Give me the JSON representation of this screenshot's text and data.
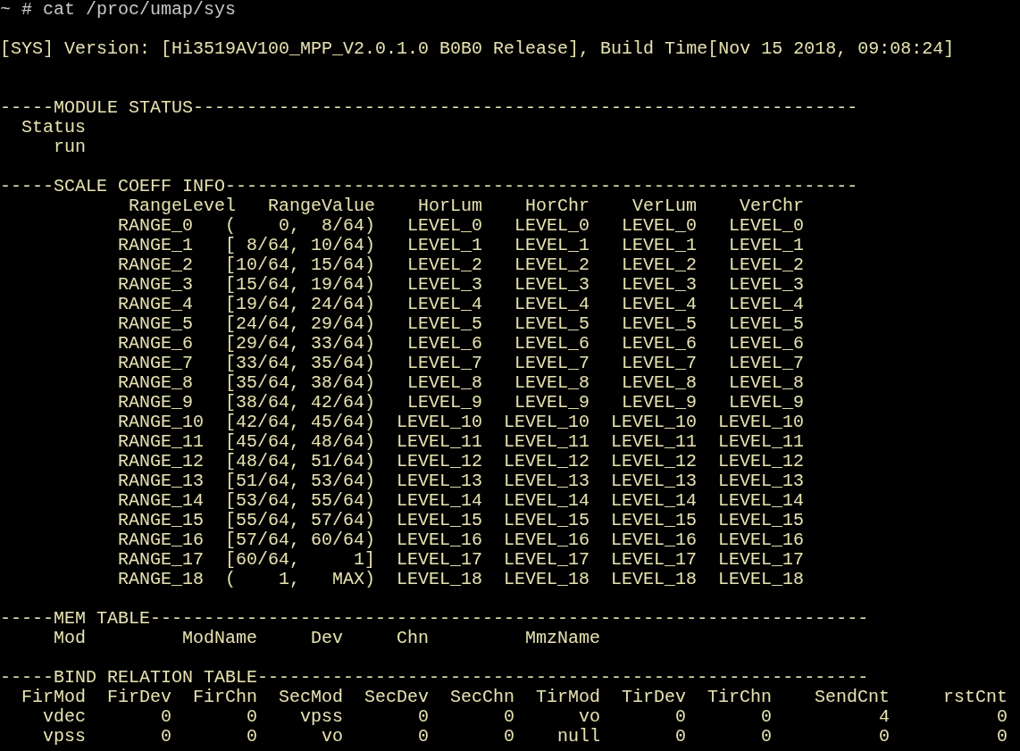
{
  "terminal": {
    "command": "~ # cat /proc/umap/sys",
    "version": "[SYS] Version: [Hi3519AV100_MPP_V2.0.1.0 B0B0 Release], Build Time[Nov 15 2018, 09:08:24]",
    "sections": [
      {
        "kind": "status",
        "title": "-----MODULE STATUS--------------------------------------------------------------",
        "columns": [
          "Status"
        ],
        "rows": [
          [
            "run"
          ]
        ]
      },
      {
        "kind": "scale",
        "title": "-----SCALE COEFF INFO-----------------------------------------------------------",
        "columns": [
          "RangeLevel",
          "RangeValue",
          "HorLum",
          "HorChr",
          "VerLum",
          "VerChr"
        ],
        "rows": [
          [
            "RANGE_0",
            "(    0,  8/64)",
            "LEVEL_0",
            "LEVEL_0",
            "LEVEL_0",
            "LEVEL_0"
          ],
          [
            "RANGE_1",
            "[ 8/64, 10/64)",
            "LEVEL_1",
            "LEVEL_1",
            "LEVEL_1",
            "LEVEL_1"
          ],
          [
            "RANGE_2",
            "[10/64, 15/64)",
            "LEVEL_2",
            "LEVEL_2",
            "LEVEL_2",
            "LEVEL_2"
          ],
          [
            "RANGE_3",
            "[15/64, 19/64)",
            "LEVEL_3",
            "LEVEL_3",
            "LEVEL_3",
            "LEVEL_3"
          ],
          [
            "RANGE_4",
            "[19/64, 24/64)",
            "LEVEL_4",
            "LEVEL_4",
            "LEVEL_4",
            "LEVEL_4"
          ],
          [
            "RANGE_5",
            "[24/64, 29/64)",
            "LEVEL_5",
            "LEVEL_5",
            "LEVEL_5",
            "LEVEL_5"
          ],
          [
            "RANGE_6",
            "[29/64, 33/64)",
            "LEVEL_6",
            "LEVEL_6",
            "LEVEL_6",
            "LEVEL_6"
          ],
          [
            "RANGE_7",
            "[33/64, 35/64)",
            "LEVEL_7",
            "LEVEL_7",
            "LEVEL_7",
            "LEVEL_7"
          ],
          [
            "RANGE_8",
            "[35/64, 38/64)",
            "LEVEL_8",
            "LEVEL_8",
            "LEVEL_8",
            "LEVEL_8"
          ],
          [
            "RANGE_9",
            "[38/64, 42/64)",
            "LEVEL_9",
            "LEVEL_9",
            "LEVEL_9",
            "LEVEL_9"
          ],
          [
            "RANGE_10",
            "[42/64, 45/64)",
            "LEVEL_10",
            "LEVEL_10",
            "LEVEL_10",
            "LEVEL_10"
          ],
          [
            "RANGE_11",
            "[45/64, 48/64)",
            "LEVEL_11",
            "LEVEL_11",
            "LEVEL_11",
            "LEVEL_11"
          ],
          [
            "RANGE_12",
            "[48/64, 51/64)",
            "LEVEL_12",
            "LEVEL_12",
            "LEVEL_12",
            "LEVEL_12"
          ],
          [
            "RANGE_13",
            "[51/64, 53/64)",
            "LEVEL_13",
            "LEVEL_13",
            "LEVEL_13",
            "LEVEL_13"
          ],
          [
            "RANGE_14",
            "[53/64, 55/64)",
            "LEVEL_14",
            "LEVEL_14",
            "LEVEL_14",
            "LEVEL_14"
          ],
          [
            "RANGE_15",
            "[55/64, 57/64)",
            "LEVEL_15",
            "LEVEL_15",
            "LEVEL_15",
            "LEVEL_15"
          ],
          [
            "RANGE_16",
            "[57/64, 60/64)",
            "LEVEL_16",
            "LEVEL_16",
            "LEVEL_16",
            "LEVEL_16"
          ],
          [
            "RANGE_17",
            "[60/64,     1]",
            "LEVEL_17",
            "LEVEL_17",
            "LEVEL_17",
            "LEVEL_17"
          ],
          [
            "RANGE_18",
            "(    1,   MAX)",
            "LEVEL_18",
            "LEVEL_18",
            "LEVEL_18",
            "LEVEL_18"
          ]
        ]
      },
      {
        "kind": "mem",
        "title": "-----MEM TABLE-------------------------------------------------------------------",
        "columns": [
          "Mod",
          "ModName",
          "Dev",
          "Chn",
          "MmzName"
        ]
      },
      {
        "kind": "bind",
        "title": "-----BIND RELATION TABLE---------------------------------------------------------",
        "columns": [
          "FirMod",
          "FirDev",
          "FirChn",
          "SecMod",
          "SecDev",
          "SecChn",
          "TirMod",
          "TirDev",
          "TirChn",
          "SendCnt",
          "rstCnt"
        ],
        "rows": [
          [
            "vdec",
            "0",
            "0",
            "vpss",
            "0",
            "0",
            "vo",
            "0",
            "0",
            "4",
            "0"
          ],
          [
            "vpss",
            "0",
            "0",
            "vo",
            "0",
            "0",
            "null",
            "0",
            "0",
            "0",
            "0"
          ]
        ]
      }
    ]
  }
}
